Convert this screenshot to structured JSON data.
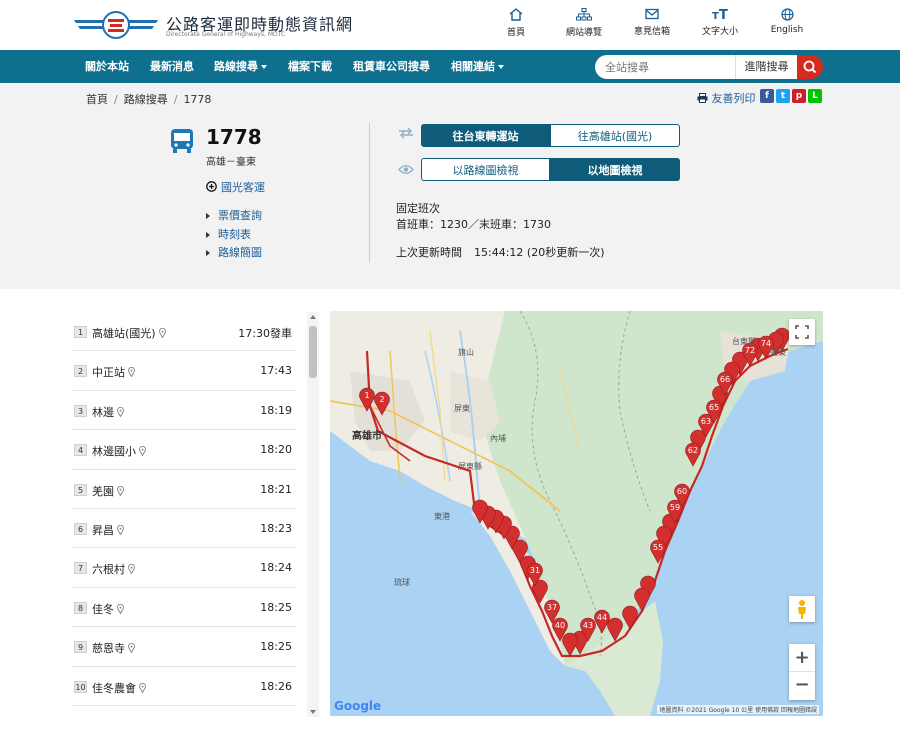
{
  "header": {
    "site_title": "公路客運即時動態資訊網",
    "site_subtitle": "Directorate General of Highways, MOTC",
    "tools": [
      {
        "label": "首頁",
        "icon": "home-icon"
      },
      {
        "label": "網站導覽",
        "icon": "sitemap-icon"
      },
      {
        "label": "意見信箱",
        "icon": "mail-icon"
      },
      {
        "label": "文字大小",
        "icon": "text-size-icon"
      },
      {
        "label": "English",
        "icon": "globe-icon"
      }
    ]
  },
  "nav": {
    "items": [
      "關於本站",
      "最新消息",
      "路線搜尋",
      "檔案下載",
      "租賃車公司搜尋",
      "相關連結"
    ],
    "search_placeholder": "全站搜尋",
    "advanced_search": "進階搜尋"
  },
  "breadcrumb": [
    "首頁",
    "路線搜尋",
    "1778"
  ],
  "share": {
    "print_label": "友善列印",
    "icons": [
      "facebook-icon",
      "twitter-icon",
      "pinterest-icon",
      "line-icon"
    ]
  },
  "route": {
    "number": "1778",
    "name": "高雄－臺東",
    "company": "國光客運",
    "links": [
      "票價查詢",
      "時刻表",
      "路線簡圖"
    ],
    "direction_tabs": [
      "往台東轉運站",
      "往高雄站(國光)"
    ],
    "view_tabs": [
      "以路線圖檢視",
      "以地圖檢視"
    ],
    "schedule_type": "固定班次",
    "first_last": "首班車：1230／末班車：1730",
    "updated_label": "上次更新時間",
    "updated_time": "15:44:12 (20秒更新一次)"
  },
  "stops": [
    {
      "no": "1",
      "name": "高雄站(國光)",
      "time": "17:30發車"
    },
    {
      "no": "2",
      "name": "中正站",
      "time": "17:43"
    },
    {
      "no": "3",
      "name": "林邊",
      "time": "18:19"
    },
    {
      "no": "4",
      "name": "林邊國小",
      "time": "18:20"
    },
    {
      "no": "5",
      "name": "羌園",
      "time": "18:21"
    },
    {
      "no": "6",
      "name": "昇昌",
      "time": "18:23"
    },
    {
      "no": "7",
      "name": "六根村",
      "time": "18:24"
    },
    {
      "no": "8",
      "name": "佳冬",
      "time": "18:25"
    },
    {
      "no": "9",
      "name": "慈恩寺",
      "time": "18:25"
    },
    {
      "no": "10",
      "name": "佳冬農會",
      "time": "18:26"
    }
  ],
  "map": {
    "labels": [
      "高雄市",
      "屏東縣",
      "台東縣",
      "內埔",
      "東港",
      "琉球",
      "屏東",
      "旗山",
      "臺東"
    ],
    "markers": [
      "1",
      "2",
      "31",
      "37",
      "40",
      "43",
      "44",
      "55",
      "59",
      "60",
      "62",
      "63",
      "65",
      "66",
      "72",
      "74"
    ],
    "google": "Google",
    "attribution": "地圖資料 ©2021 Google   10 公里   使用條款   回報地圖錯誤",
    "zoom_in": "+",
    "zoom_out": "−"
  },
  "colors": {
    "nav": "#0f6f8f",
    "accent": "#0f5c7a",
    "search": "#d52b1e",
    "marker": "#d32f2f"
  }
}
